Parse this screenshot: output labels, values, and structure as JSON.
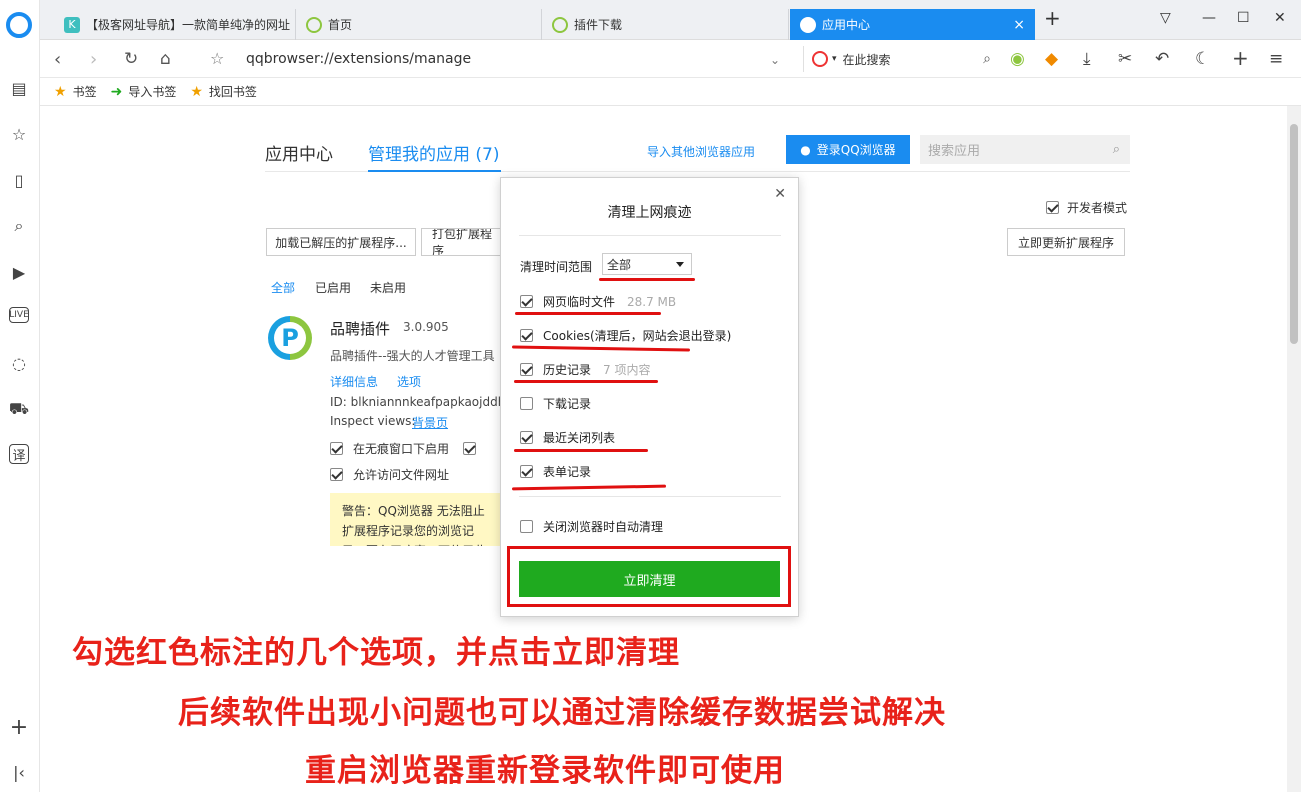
{
  "tabs": [
    {
      "label": "【极客网址导航】一款简单纯净的网址",
      "favicon": "K"
    },
    {
      "label": "首页"
    },
    {
      "label": "插件下载"
    },
    {
      "label": "应用中心",
      "active": true
    }
  ],
  "address": {
    "url": "qqbrowser://extensions/manage",
    "search_placeholder": "在此搜索"
  },
  "bookmarks": [
    {
      "label": "书签"
    },
    {
      "label": "导入书签"
    },
    {
      "label": "找回书签"
    }
  ],
  "page": {
    "tab_app_center": "应用中心",
    "tab_manage": "管理我的应用 (7)",
    "import_link": "导入其他浏览器应用",
    "login_btn": "登录QQ浏览器",
    "search_placeholder": "搜索应用",
    "dev_mode": "开发者模式",
    "load_btn": "加载已解压的扩展程序...",
    "pack_btn": "打包扩展程序",
    "update_btn": "立即更新扩展程序",
    "filters": [
      "全部",
      "已启用",
      "未启用"
    ],
    "ext": {
      "name": "品聘插件",
      "version": "3.0.905",
      "desc": "品聘插件--强大的人才管理工具",
      "detail_link": "详细信息",
      "options_link": "选项",
      "id": "ID: blkniannnkeafpapkaojddhem",
      "inspect_label": "Inspect views:",
      "inspect_link": "背景页",
      "incognito": "在无痕窗口下启用",
      "file_access": "允许访问文件网址"
    },
    "warning": "警告：QQ浏览器 无法阻止扩展程序记录您的浏览记录。要在无痕窗口下停用此扩展程序"
  },
  "dialog": {
    "title": "清理上网痕迹",
    "range_label": "清理时间范围",
    "range_value": "全部",
    "options": [
      {
        "label": "网页临时文件",
        "note": "28.7 MB",
        "checked": true
      },
      {
        "label": "Cookies(清理后，网站会退出登录)",
        "note": "",
        "checked": true
      },
      {
        "label": "历史记录",
        "note": "7 项内容",
        "checked": true
      },
      {
        "label": "下载记录",
        "note": "",
        "checked": false
      },
      {
        "label": "最近关闭列表",
        "note": "",
        "checked": true
      },
      {
        "label": "表单记录",
        "note": "",
        "checked": true
      }
    ],
    "auto_clean": "关闭浏览器时自动清理",
    "clean_btn": "立即清理"
  },
  "captions": [
    "勾选红色标注的几个选项，并点击立即清理",
    "后续软件出现小问题也可以通过清除缓存数据尝试解决",
    "重启浏览器重新登录软件即可使用"
  ],
  "colors": {
    "accent": "#1a8cf0",
    "clean_green": "#1faa1f",
    "annotation_red": "#e01010"
  }
}
